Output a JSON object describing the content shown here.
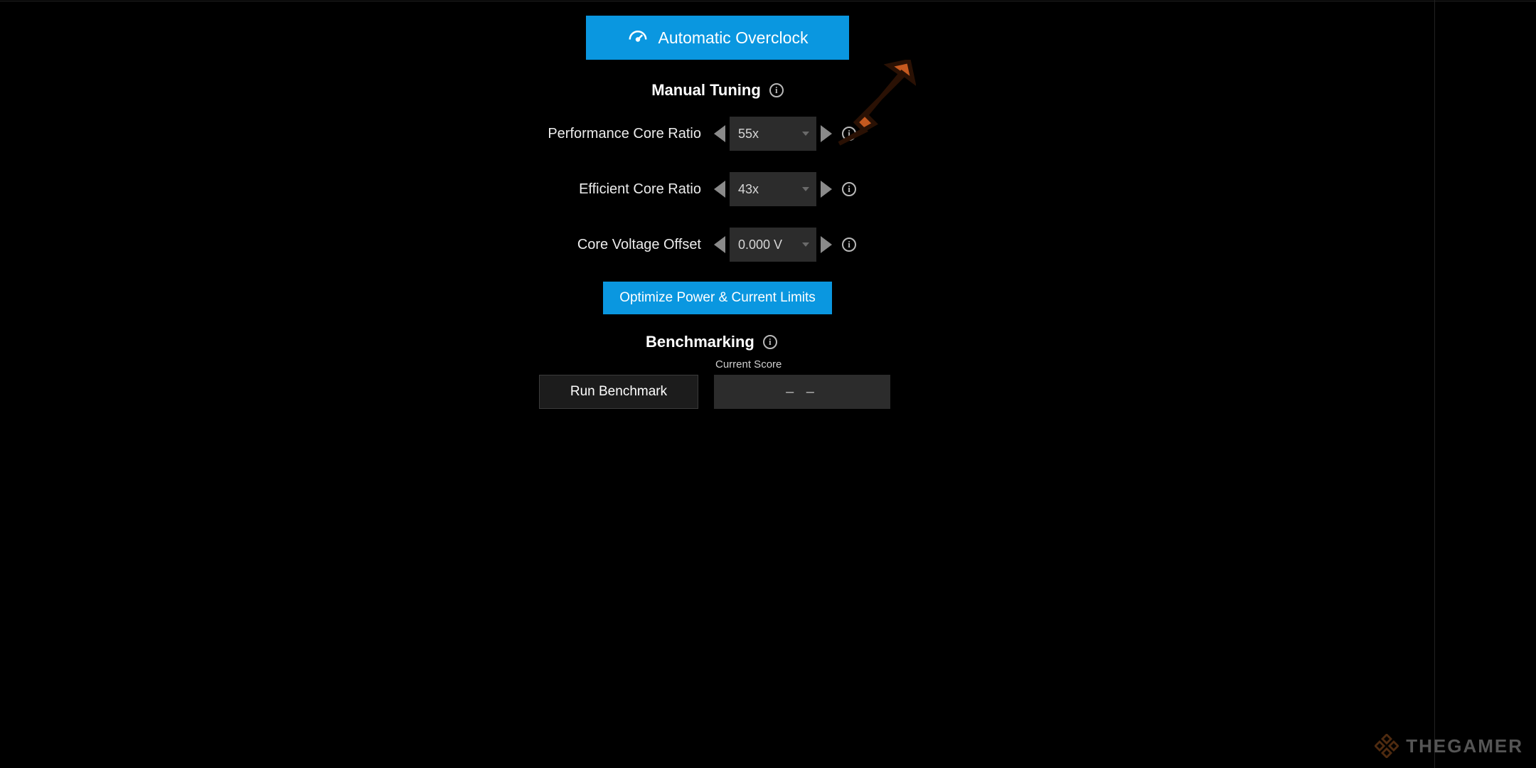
{
  "buttons": {
    "auto_overclock": "Automatic Overclock",
    "optimize": "Optimize Power & Current Limits",
    "run_benchmark": "Run Benchmark"
  },
  "sections": {
    "manual_tuning": "Manual Tuning",
    "benchmarking": "Benchmarking"
  },
  "tuning": {
    "perf_label": "Performance Core Ratio",
    "perf_value": "55x",
    "eff_label": "Efficient Core Ratio",
    "eff_value": "43x",
    "volt_label": "Core Voltage Offset",
    "volt_value": "0.000 V"
  },
  "benchmark": {
    "score_label": "Current Score",
    "score_value": "–  –"
  },
  "watermark": "THEGAMER",
  "colors": {
    "accent": "#0a97e0",
    "annotation": "#c4571e"
  }
}
